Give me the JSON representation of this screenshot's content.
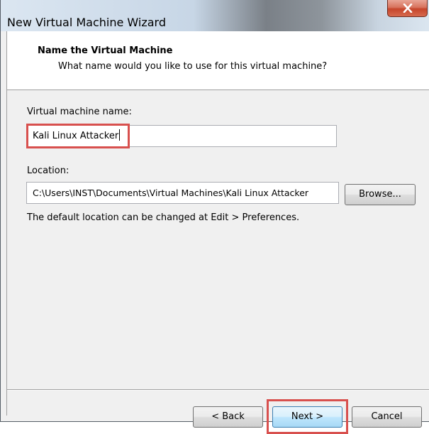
{
  "window": {
    "title": "New Virtual Machine Wizard"
  },
  "header": {
    "title": "Name the Virtual Machine",
    "subtitle": "What name would you like to use for this virtual machine?"
  },
  "form": {
    "name_label": "Virtual machine name:",
    "name_value": "Kali Linux Attacker",
    "location_label": "Location:",
    "location_value": "C:\\Users\\INST\\Documents\\Virtual Machines\\Kali Linux Attacker",
    "browse_label": "Browse...",
    "hint": "The default location can be changed at Edit > Preferences."
  },
  "footer": {
    "back_label": "< Back",
    "next_label": "Next >",
    "cancel_label": "Cancel"
  },
  "icons": {
    "close": "close-icon"
  },
  "colors": {
    "highlight": "#d8504e",
    "close_button": "#c6452b",
    "default_button_border": "#3c7fb1"
  }
}
